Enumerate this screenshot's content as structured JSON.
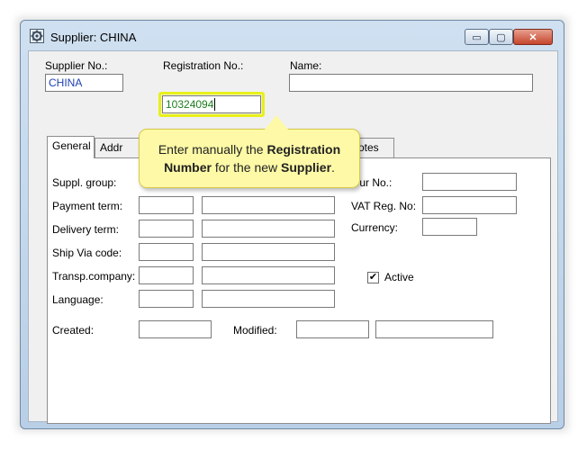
{
  "window": {
    "title": "Supplier: CHINA",
    "buttons": {
      "minimize": "▭",
      "maximize": "▢",
      "close": "✕"
    }
  },
  "header": {
    "supplier_no": {
      "label": "Supplier No.:",
      "value": "CHINA"
    },
    "registration_no": {
      "label": "Registration No.:",
      "value": "10324094"
    },
    "name": {
      "label": "Name:",
      "value": ""
    }
  },
  "tabs": [
    {
      "label": "General",
      "active": true
    },
    {
      "label": "Addr"
    },
    {
      "label": "otes"
    }
  ],
  "callout": {
    "part1": "Enter manually the ",
    "bold1": "Registration",
    "part2": "Number",
    "part3": " for the new ",
    "bold2": "Supplier",
    "part4": "."
  },
  "general": {
    "suppl_group": "Suppl. group:",
    "payment_term": "Payment term:",
    "delivery_term": "Delivery term:",
    "ship_via": "Ship Via code:",
    "transp_company": "Transp.company:",
    "language": "Language:",
    "created": "Created:",
    "modified": "Modified:",
    "our_no": "Our No.:",
    "vat_reg": "VAT Reg. No:",
    "currency": "Currency:",
    "active": {
      "label": "Active",
      "checked": "✔"
    }
  },
  "colors": {
    "callout_bg": "#fdf9a6",
    "highlight": "#e8f01a",
    "supplier_text": "#1f3fb0",
    "registration_text": "#1c7d1c"
  }
}
